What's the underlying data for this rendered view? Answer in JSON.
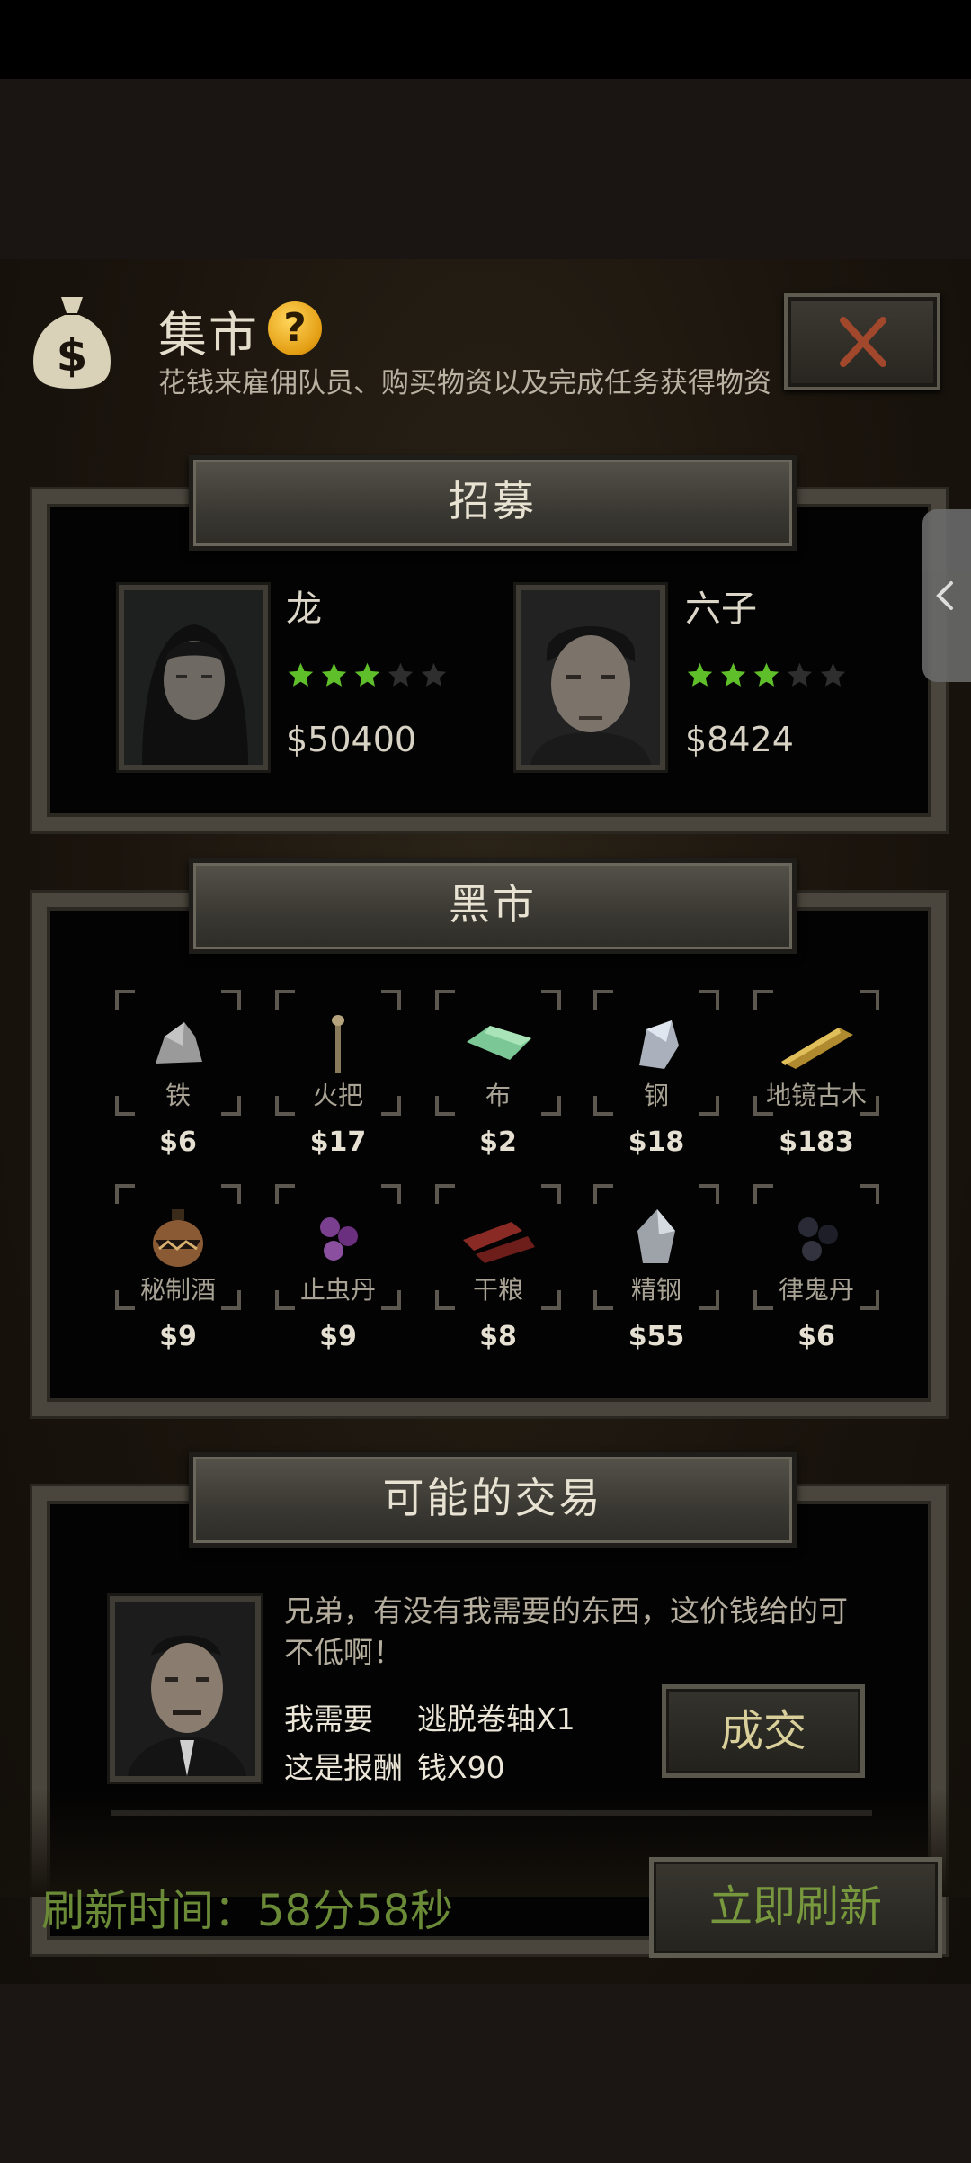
{
  "header": {
    "title": "集市",
    "help": "?",
    "subtitle": "花钱来雇佣队员、购买物资以及完成任务获得物资",
    "icons": {
      "bag": "moneybag-icon",
      "help": "question-icon",
      "close": "close-icon"
    }
  },
  "recruit": {
    "banner": "招募",
    "members": [
      {
        "name": "龙",
        "stars": 3,
        "max_stars": 5,
        "price": "$50400"
      },
      {
        "name": "六子",
        "stars": 3,
        "max_stars": 5,
        "price": "$8424"
      }
    ]
  },
  "black_market": {
    "banner": "黑市",
    "items": [
      {
        "name": "铁",
        "price": "$6",
        "icon": "iron-ore-icon"
      },
      {
        "name": "火把",
        "price": "$17",
        "icon": "torch-icon"
      },
      {
        "name": "布",
        "price": "$2",
        "icon": "cloth-icon"
      },
      {
        "name": "钢",
        "price": "$18",
        "icon": "steel-ore-icon"
      },
      {
        "name": "地镜古木",
        "price": "$183",
        "icon": "ancient-wood-icon"
      },
      {
        "name": "秘制酒",
        "price": "$9",
        "icon": "wine-jar-icon"
      },
      {
        "name": "止虫丹",
        "price": "$9",
        "icon": "purple-pills-icon"
      },
      {
        "name": "干粮",
        "price": "$8",
        "icon": "dried-meat-icon"
      },
      {
        "name": "精钢",
        "price": "$55",
        "icon": "refined-steel-icon"
      },
      {
        "name": "律鬼丹",
        "price": "$6",
        "icon": "black-pills-icon"
      }
    ]
  },
  "trade": {
    "banner": "可能的交易",
    "message_line1": "兄弟，有没有我需要的东西，这价钱给的可",
    "message_line2": "不低啊！",
    "need_label": "我需要",
    "need_value": "逃脱卷轴X1",
    "reward_label": "这是报酬",
    "reward_value": "钱X90",
    "deal_button": "成交"
  },
  "footer": {
    "refresh_time": "刷新时间：58分58秒",
    "refresh_button": "立即刷新"
  },
  "colors": {
    "star_on": "#5fbf2a",
    "star_off": "#2e2e2e",
    "refresh_green": "#6a8a37"
  }
}
